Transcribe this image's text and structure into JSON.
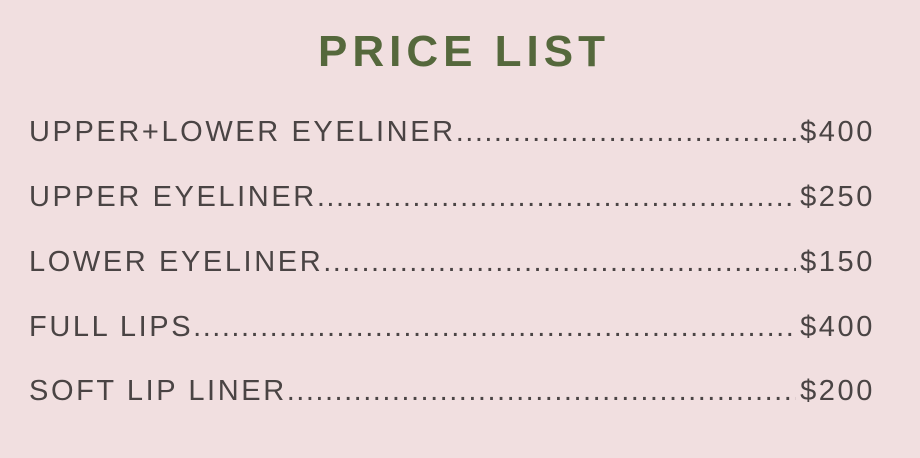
{
  "title": "PRICE LIST",
  "leader_dots": "........................................................................................................................",
  "items": [
    {
      "name": "UPPER+LOWER EYELINER",
      "price": "$400"
    },
    {
      "name": "UPPER EYELINER",
      "price": "$250"
    },
    {
      "name": "LOWER EYELINER",
      "price": "$150"
    },
    {
      "name": "FULL LIPS",
      "price": "$400"
    },
    {
      "name": "SOFT LIP LINER",
      "price": "$200"
    }
  ]
}
